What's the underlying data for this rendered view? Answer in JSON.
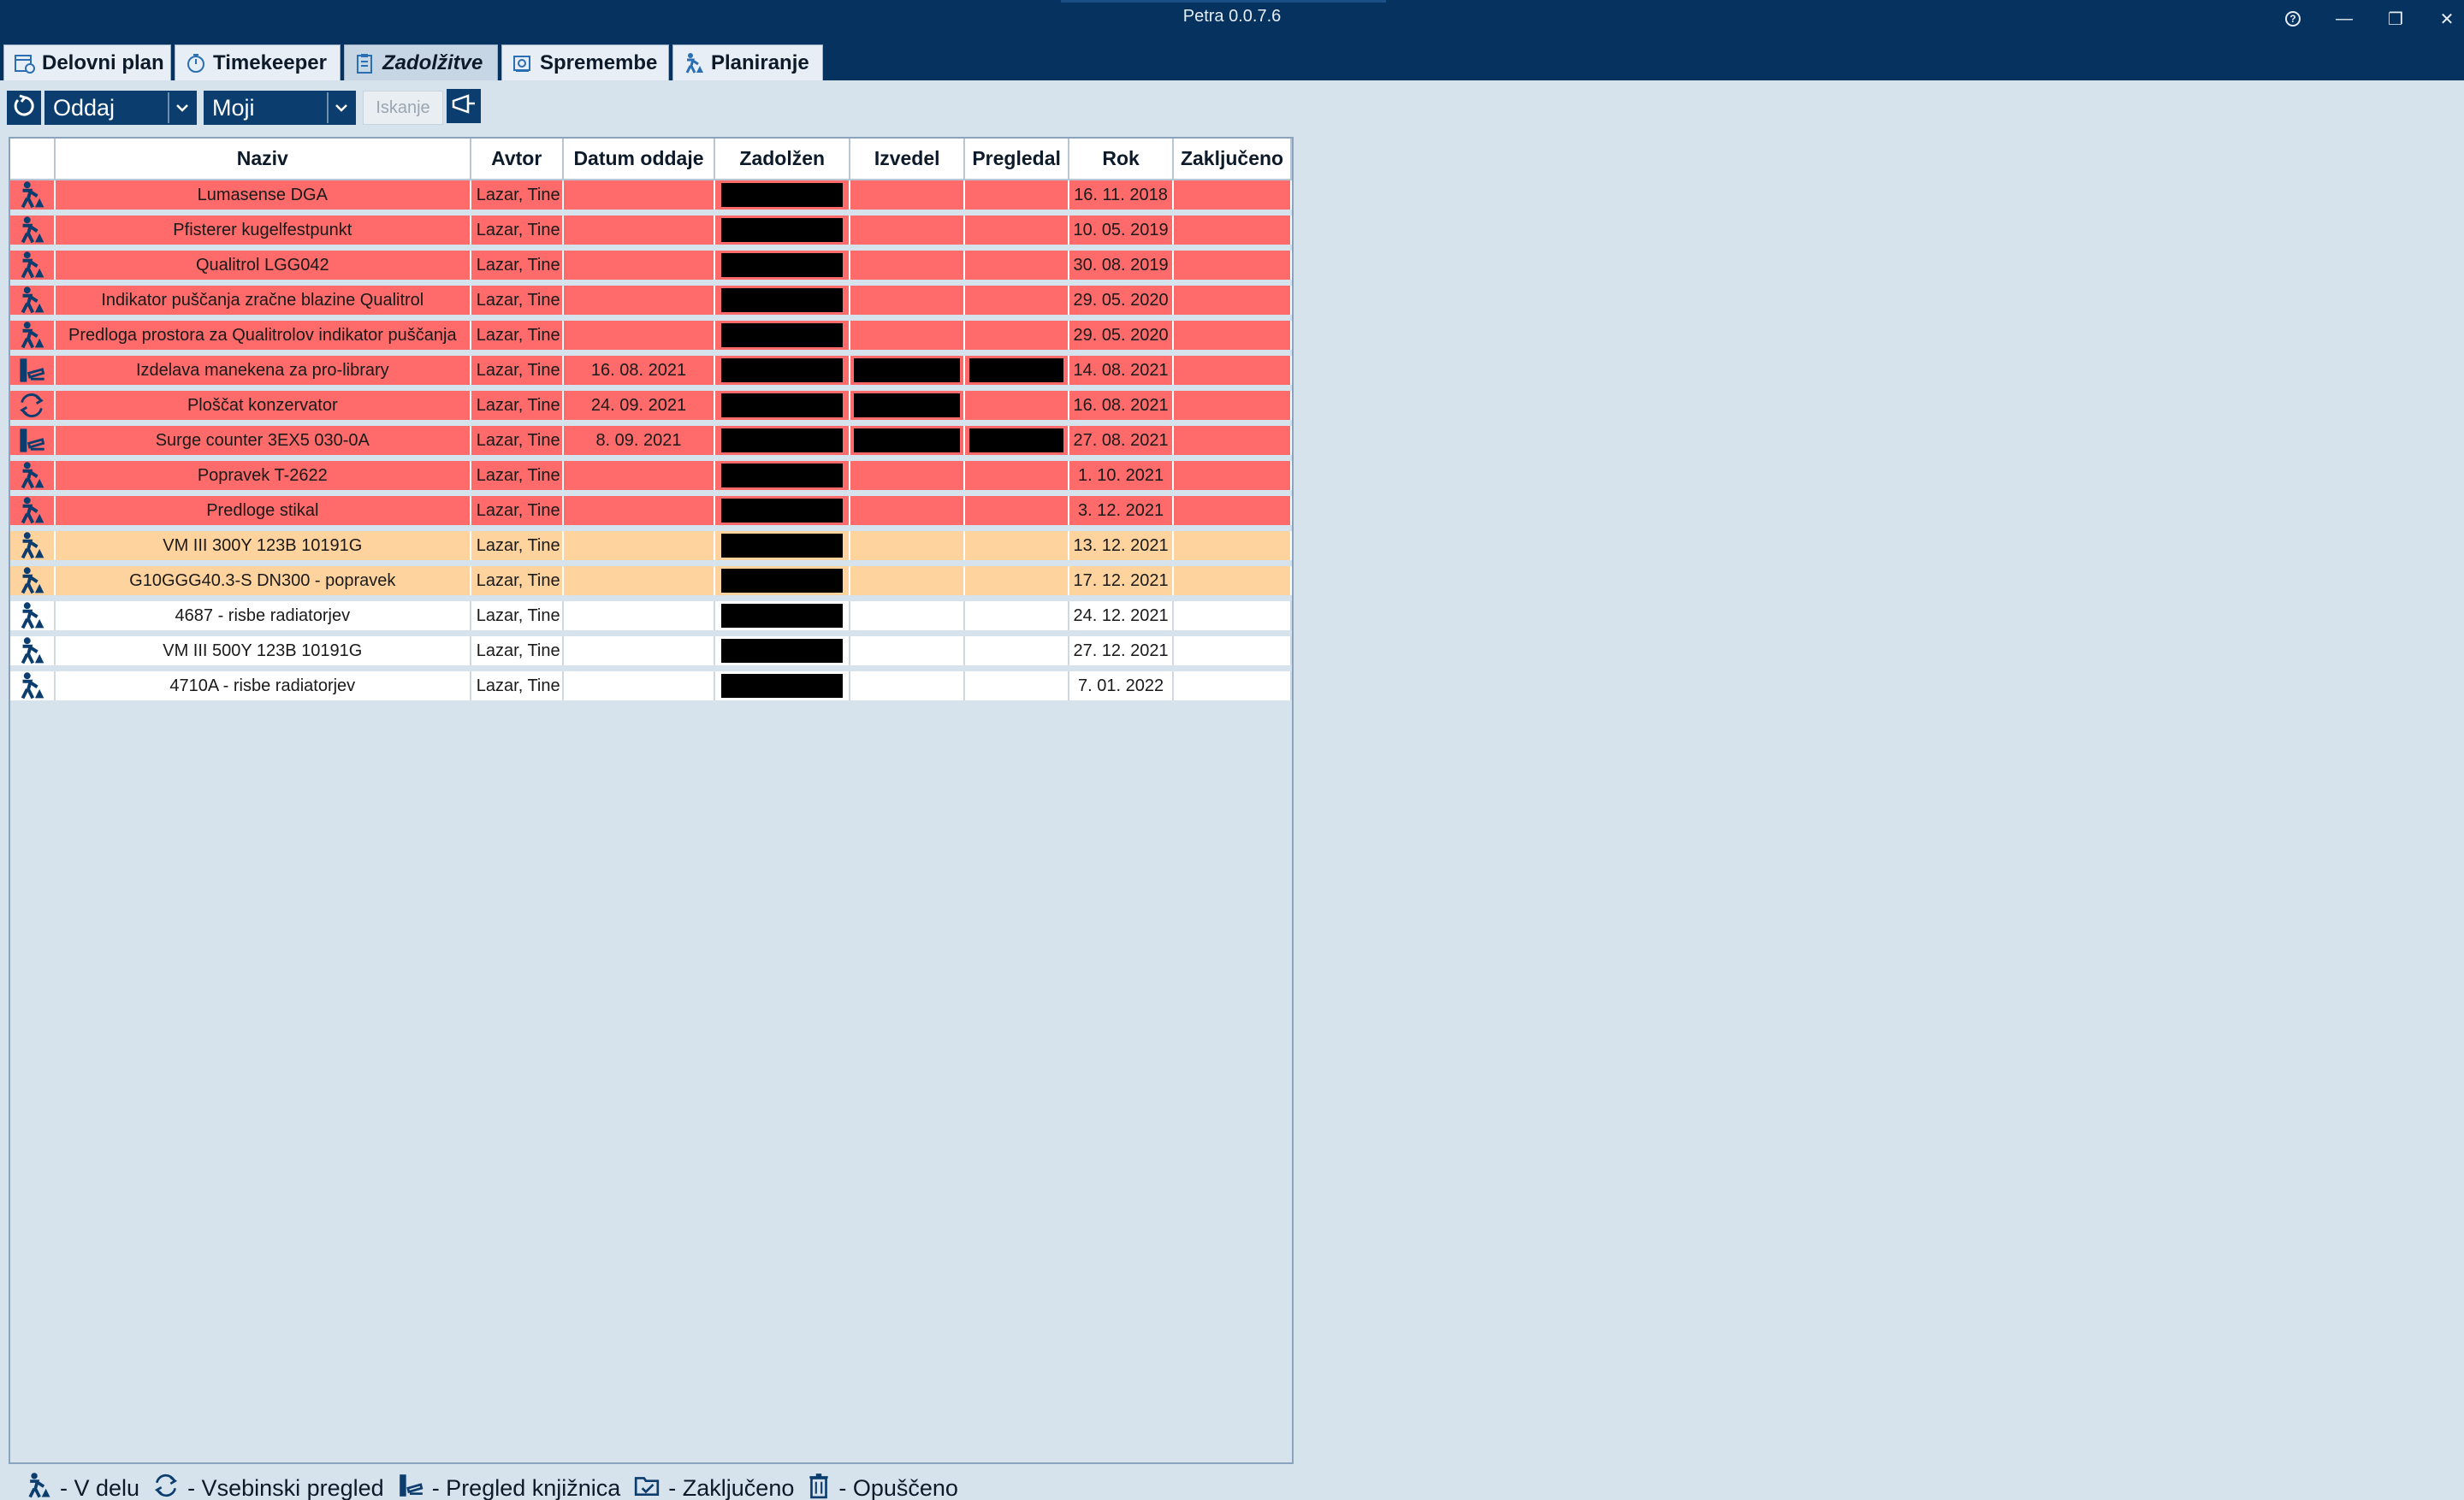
{
  "window": {
    "title": "Petra 0.0.7.6",
    "help_glyph": "?",
    "minimize_glyph": "—",
    "restore_glyph": "❐",
    "close_glyph": "✕"
  },
  "tabs": [
    {
      "label": "Delovni plan",
      "icon": "calendar-icon"
    },
    {
      "label": "Timekeeper",
      "icon": "stopwatch-icon"
    },
    {
      "label": "Zadolžitve",
      "icon": "clipboard-icon",
      "active": true
    },
    {
      "label": "Spremembe",
      "icon": "change-icon"
    },
    {
      "label": "Planiranje",
      "icon": "worker-icon"
    }
  ],
  "toolbar": {
    "refresh_icon": "refresh-icon",
    "type_combo": "Oddaj",
    "filter_combo": "Moji",
    "search_placeholder": "Iskanje",
    "export_icon": "export-icon"
  },
  "grid": {
    "columns": [
      "",
      "Naziv",
      "Avtor",
      "Datum oddaje",
      "Zadolžen",
      "Izvedel",
      "Pregledal",
      "Rok",
      "Zaključeno"
    ],
    "rows": [
      {
        "status": "V delu",
        "naziv": "Lumasense DGA",
        "avtor": "Lazar, Tine",
        "datum": "",
        "zadolzen": true,
        "izvedel": false,
        "pregledal": false,
        "rok": "16. 11. 2018",
        "zakljuceno": "",
        "color": "red"
      },
      {
        "status": "V delu",
        "naziv": "Pfisterer kugelfestpunkt",
        "avtor": "Lazar, Tine",
        "datum": "",
        "zadolzen": true,
        "izvedel": false,
        "pregledal": false,
        "rok": "10. 05. 2019",
        "zakljuceno": "",
        "color": "red"
      },
      {
        "status": "V delu",
        "naziv": "Qualitrol LGG042",
        "avtor": "Lazar, Tine",
        "datum": "",
        "zadolzen": true,
        "izvedel": false,
        "pregledal": false,
        "rok": "30. 08. 2019",
        "zakljuceno": "",
        "color": "red"
      },
      {
        "status": "V delu",
        "naziv": "Indikator puščanja zračne blazine Qualitrol",
        "avtor": "Lazar, Tine",
        "datum": "",
        "zadolzen": true,
        "izvedel": false,
        "pregledal": false,
        "rok": "29. 05. 2020",
        "zakljuceno": "",
        "color": "red"
      },
      {
        "status": "V delu",
        "naziv": "Predloga prostora za Qualitrolov indikator puščanja",
        "avtor": "Lazar, Tine",
        "datum": "",
        "zadolzen": true,
        "izvedel": false,
        "pregledal": false,
        "rok": "29. 05. 2020",
        "zakljuceno": "",
        "color": "red"
      },
      {
        "status": "Pregled knjižnica",
        "naziv": "Izdelava manekena za pro-library",
        "avtor": "Lazar, Tine",
        "datum": "16. 08. 2021",
        "zadolzen": true,
        "izvedel": true,
        "pregledal": true,
        "rok": "14. 08. 2021",
        "zakljuceno": "",
        "color": "red"
      },
      {
        "status": "Vsebinski pregled",
        "naziv": "Ploščat konzervator",
        "avtor": "Lazar, Tine",
        "datum": "24. 09. 2021",
        "zadolzen": true,
        "izvedel": true,
        "pregledal": false,
        "rok": "16. 08. 2021",
        "zakljuceno": "",
        "color": "red"
      },
      {
        "status": "Pregled knjižnica",
        "naziv": "Surge counter 3EX5 030-0A",
        "avtor": "Lazar, Tine",
        "datum": "8. 09. 2021",
        "zadolzen": true,
        "izvedel": true,
        "pregledal": true,
        "rok": "27. 08. 2021",
        "zakljuceno": "",
        "color": "red"
      },
      {
        "status": "V delu",
        "naziv": "Popravek T-2622",
        "avtor": "Lazar, Tine",
        "datum": "",
        "zadolzen": true,
        "izvedel": false,
        "pregledal": false,
        "rok": "1. 10. 2021",
        "zakljuceno": "",
        "color": "red"
      },
      {
        "status": "V delu",
        "naziv": "Predloge stikal",
        "avtor": "Lazar, Tine",
        "datum": "",
        "zadolzen": true,
        "izvedel": false,
        "pregledal": false,
        "rok": "3. 12. 2021",
        "zakljuceno": "",
        "color": "red"
      },
      {
        "status": "V delu",
        "naziv": "VM III 300Y 123B 10191G",
        "avtor": "Lazar, Tine",
        "datum": "",
        "zadolzen": true,
        "izvedel": false,
        "pregledal": false,
        "rok": "13. 12. 2021",
        "zakljuceno": "",
        "color": "orange"
      },
      {
        "status": "V delu",
        "naziv": "G10GGG40.3-S DN300 - popravek",
        "avtor": "Lazar, Tine",
        "datum": "",
        "zadolzen": true,
        "izvedel": false,
        "pregledal": false,
        "rok": "17. 12. 2021",
        "zakljuceno": "",
        "color": "orange"
      },
      {
        "status": "V delu",
        "naziv": "4687 - risbe radiatorjev",
        "avtor": "Lazar, Tine",
        "datum": "",
        "zadolzen": true,
        "izvedel": false,
        "pregledal": false,
        "rok": "24. 12. 2021",
        "zakljuceno": "",
        "color": "white"
      },
      {
        "status": "V delu",
        "naziv": "VM III 500Y 123B 10191G",
        "avtor": "Lazar, Tine",
        "datum": "",
        "zadolzen": true,
        "izvedel": false,
        "pregledal": false,
        "rok": "27. 12. 2021",
        "zakljuceno": "",
        "color": "white"
      },
      {
        "status": "V delu",
        "naziv": "4710A - risbe radiatorjev",
        "avtor": "Lazar, Tine",
        "datum": "",
        "zadolzen": true,
        "izvedel": false,
        "pregledal": false,
        "rok": "7. 01. 2022",
        "zakljuceno": "",
        "color": "white"
      }
    ]
  },
  "legend": [
    {
      "icon": "worker-icon",
      "label": "- V delu"
    },
    {
      "icon": "refresh-icon",
      "label": "- Vsebinski pregled"
    },
    {
      "icon": "library-icon",
      "label": "- Pregled knjižnica"
    },
    {
      "icon": "folder-check-icon",
      "label": "- Zaključeno"
    },
    {
      "icon": "trash-icon",
      "label": "- Opuščeno"
    }
  ],
  "colors": {
    "titlebar": "#05325f",
    "overdue_row": "#ff6a6a",
    "soon_row": "#ffd39e",
    "normal_row": "#ffffff",
    "background": "#d6e2ec"
  }
}
